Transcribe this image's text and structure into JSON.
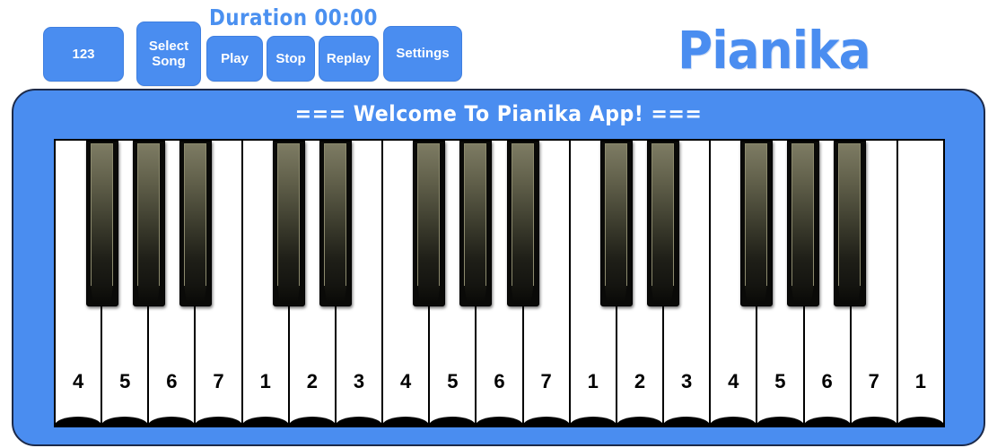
{
  "app": {
    "title": "Pianika",
    "welcome_banner": "=== Welcome To Pianika App! ===",
    "accent_blue": "#4a8df0",
    "panel_border": "#1c2a4a"
  },
  "toolbar": {
    "duration_label": "Duration 00:00",
    "buttons": [
      {
        "id": "123",
        "label": "123"
      },
      {
        "id": "select",
        "label": "Select Song"
      },
      {
        "id": "play",
        "label": "Play"
      },
      {
        "id": "stop",
        "label": "Stop"
      },
      {
        "id": "replay",
        "label": "Replay"
      },
      {
        "id": "settings",
        "label": "Settings"
      }
    ]
  },
  "keyboard": {
    "white_keys": [
      {
        "index": 0,
        "label": "4"
      },
      {
        "index": 1,
        "label": "5"
      },
      {
        "index": 2,
        "label": "6"
      },
      {
        "index": 3,
        "label": "7"
      },
      {
        "index": 4,
        "label": "1"
      },
      {
        "index": 5,
        "label": "2"
      },
      {
        "index": 6,
        "label": "3"
      },
      {
        "index": 7,
        "label": "4"
      },
      {
        "index": 8,
        "label": "5"
      },
      {
        "index": 9,
        "label": "6"
      },
      {
        "index": 10,
        "label": "7"
      },
      {
        "index": 11,
        "label": "1"
      },
      {
        "index": 12,
        "label": "2"
      },
      {
        "index": 13,
        "label": "3"
      },
      {
        "index": 14,
        "label": "4"
      },
      {
        "index": 15,
        "label": "5"
      },
      {
        "index": 16,
        "label": "6"
      },
      {
        "index": 17,
        "label": "7"
      },
      {
        "index": 18,
        "label": "1"
      }
    ],
    "black_key_positions": [
      0,
      1,
      2,
      4,
      5,
      7,
      8,
      9,
      11,
      12,
      14,
      15,
      16
    ],
    "white_key_count": 19,
    "black_key_count": 13
  }
}
